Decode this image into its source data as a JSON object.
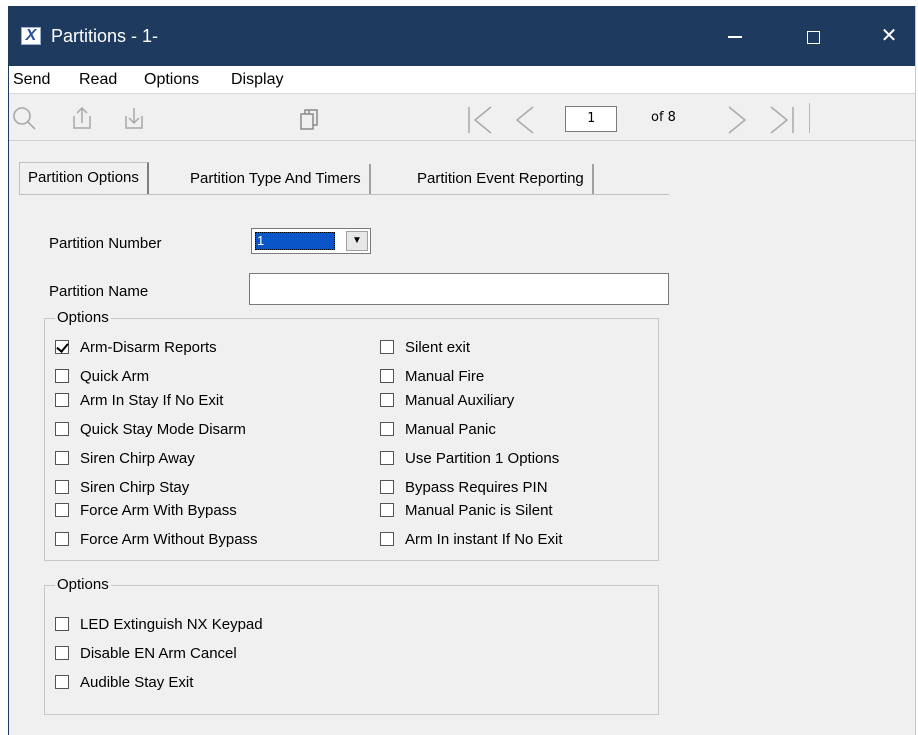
{
  "window": {
    "title": "Partitions - 1-",
    "app_icon": "X"
  },
  "menu": {
    "items": [
      "Send",
      "Read",
      "Options",
      "Display"
    ]
  },
  "toolbar": {
    "icons": [
      "search-icon",
      "upload-icon",
      "download-icon",
      "copy-icon",
      "first-page-icon",
      "previous-page-icon",
      "next-page-icon",
      "last-page-icon"
    ],
    "page_value": "1",
    "page_of": "of 8"
  },
  "tabs": [
    {
      "label": "Partition Options",
      "active": true
    },
    {
      "label": "Partition Type And Timers",
      "active": false
    },
    {
      "label": "Partition Event Reporting",
      "active": false
    }
  ],
  "form": {
    "partition_number_label": "Partition Number",
    "partition_number_value": "1",
    "partition_name_label": "Partition Name",
    "partition_name_value": ""
  },
  "options_group1": {
    "legend": "Options",
    "left": [
      {
        "label": "Arm-Disarm Reports",
        "checked": true
      },
      {
        "label": "Quick Arm",
        "checked": false
      },
      {
        "label": "Arm In Stay If No Exit",
        "checked": false
      },
      {
        "label": "Quick Stay Mode Disarm",
        "checked": false
      },
      {
        "label": "Siren Chirp Away",
        "checked": false
      },
      {
        "label": "Siren Chirp Stay",
        "checked": false
      },
      {
        "label": "Force Arm With Bypass",
        "checked": false
      },
      {
        "label": "Force Arm Without Bypass",
        "checked": false
      }
    ],
    "right": [
      {
        "label": "Silent exit",
        "checked": false
      },
      {
        "label": "Manual Fire",
        "checked": false
      },
      {
        "label": "Manual Auxiliary",
        "checked": false
      },
      {
        "label": "Manual Panic",
        "checked": false
      },
      {
        "label": "Use Partition 1 Options",
        "checked": false
      },
      {
        "label": "Bypass Requires PIN",
        "checked": false
      },
      {
        "label": "Manual Panic is Silent",
        "checked": false
      },
      {
        "label": "Arm In instant If No Exit",
        "checked": false
      }
    ]
  },
  "options_group2": {
    "legend": "Options",
    "items": [
      {
        "label": "LED Extinguish NX Keypad",
        "checked": false
      },
      {
        "label": "Disable EN Arm Cancel",
        "checked": false
      },
      {
        "label": "Audible Stay Exit",
        "checked": false
      }
    ]
  },
  "colors": {
    "titlebar": "#1f3a5f",
    "selection": "#0a56c8",
    "background": "#f0f0f0"
  }
}
